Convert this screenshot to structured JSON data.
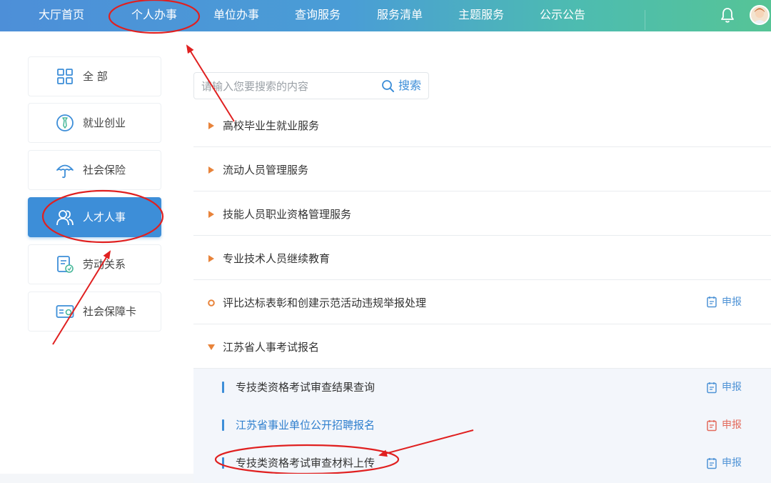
{
  "nav": {
    "items": [
      "大厅首页",
      "个人办事",
      "单位办事",
      "查询服务",
      "服务清单",
      "主题服务",
      "公示公告"
    ]
  },
  "sidebar": {
    "items": [
      {
        "label": "全  部",
        "icon": "grid-icon"
      },
      {
        "label": "就业创业",
        "icon": "tie-icon"
      },
      {
        "label": "社会保险",
        "icon": "umbrella-icon"
      },
      {
        "label": "人才人事",
        "icon": "people-icon",
        "active": true
      },
      {
        "label": "劳动关系",
        "icon": "contract-icon"
      },
      {
        "label": "社会保障卡",
        "icon": "card-icon"
      }
    ]
  },
  "search": {
    "placeholder": "请输入您要搜索的内容",
    "button_label": "搜索"
  },
  "services": {
    "rows": [
      {
        "label": "高校毕业生就业服务",
        "state": "collapsed"
      },
      {
        "label": "流动人员管理服务",
        "state": "collapsed"
      },
      {
        "label": "技能人员职业资格管理服务",
        "state": "collapsed"
      },
      {
        "label": "专业技术人员继续教育",
        "state": "collapsed"
      },
      {
        "label": "评比达标表彰和创建示范活动违规举报处理",
        "state": "leaf",
        "action": "申报"
      },
      {
        "label": "江苏省人事考试报名",
        "state": "expanded"
      }
    ],
    "subitems": [
      {
        "label": "专技类资格考试审查结果查询",
        "action": "申报"
      },
      {
        "label": "江苏省事业单位公开招聘报名",
        "action": "申报"
      },
      {
        "label": "专技类资格考试审查材料上传",
        "action": "申报"
      }
    ]
  },
  "colors": {
    "accent": "#3d8ed8",
    "marker_orange": "#e8833a",
    "annotation_red": "#e02020"
  }
}
